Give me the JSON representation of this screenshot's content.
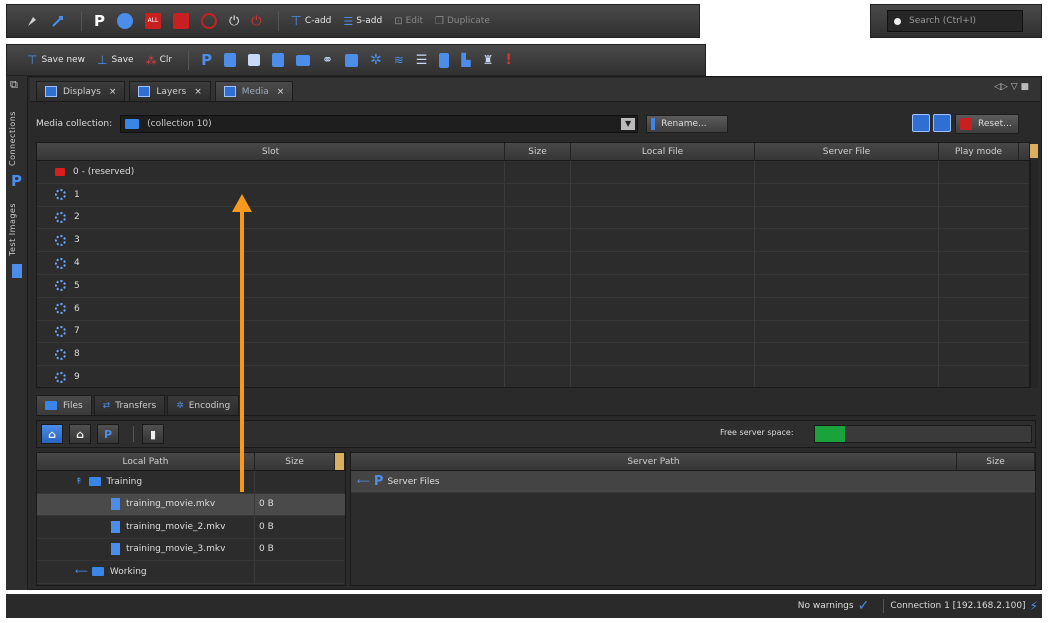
{
  "toolbar1": {
    "cadd_label": "C-add",
    "sadd_label": "S-add",
    "edit_label": "Edit",
    "duplicate_label": "Duplicate"
  },
  "search": {
    "placeholder": "Search (Ctrl+I)"
  },
  "toolbar2": {
    "save_new_label": "Save new",
    "save_label": "Save",
    "clr_label": "Clr"
  },
  "sidebar": {
    "connections_label": "Connections",
    "test_images_label": "Test Images"
  },
  "tabs": [
    {
      "label": "Displays"
    },
    {
      "label": "Layers"
    },
    {
      "label": "Media"
    }
  ],
  "collection": {
    "label": "Media collection:",
    "value": "(collection 10)",
    "rename_label": "Rename...",
    "reset_label": "Reset..."
  },
  "slot_table": {
    "columns": [
      "Slot",
      "Size",
      "Local File",
      "Server File",
      "Play mode"
    ],
    "rows": [
      "0 - (reserved)",
      "1",
      "2",
      "3",
      "4",
      "5",
      "6",
      "7",
      "8",
      "9"
    ]
  },
  "bottom_tabs": [
    {
      "label": "Files"
    },
    {
      "label": "Transfers"
    },
    {
      "label": "Encoding"
    }
  ],
  "free_space_label": "Free server space:",
  "local_table": {
    "columns": [
      "Local Path",
      "Size"
    ],
    "rows": [
      {
        "name": "Training",
        "size": ""
      },
      {
        "name": "training_movie.mkv",
        "size": "0 B"
      },
      {
        "name": "training_movie_2.mkv",
        "size": "0 B"
      },
      {
        "name": "training_movie_3.mkv",
        "size": "0 B"
      },
      {
        "name": "Working",
        "size": ""
      }
    ]
  },
  "server_table": {
    "columns": [
      "Server Path",
      "Size"
    ],
    "rows": [
      {
        "name": "Server Files",
        "size": ""
      }
    ]
  },
  "status": {
    "warnings": "No warnings",
    "connection": "Connection 1 [192.168.2.100]"
  },
  "colors": {
    "accent": "#2f6fd4",
    "arrow": "#f59a1c",
    "reserved": "#d81e1e",
    "free_space": "#1aa33a"
  }
}
